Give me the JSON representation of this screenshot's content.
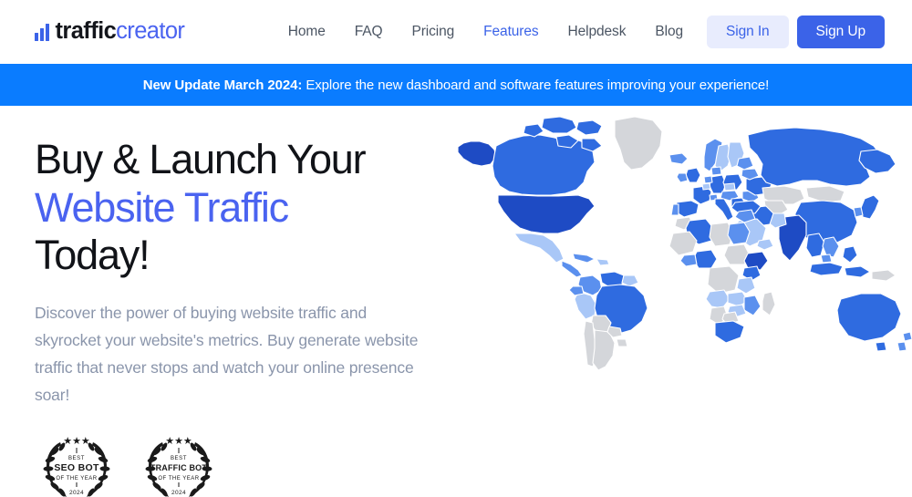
{
  "header": {
    "logo": {
      "word1": "traffic",
      "word2": "creator",
      "icon": "bar-chart-icon"
    },
    "nav": [
      {
        "label": "Home",
        "active": false,
        "name": "nav-link-home"
      },
      {
        "label": "FAQ",
        "active": false,
        "name": "nav-link-faq"
      },
      {
        "label": "Pricing",
        "active": false,
        "name": "nav-link-pricing"
      },
      {
        "label": "Features",
        "active": true,
        "name": "nav-link-features"
      },
      {
        "label": "Helpdesk",
        "active": false,
        "name": "nav-link-helpdesk"
      },
      {
        "label": "Blog",
        "active": false,
        "name": "nav-link-blog"
      }
    ],
    "sign_in_label": "Sign In",
    "sign_up_label": "Sign Up"
  },
  "banner": {
    "bold_prefix": "New Update March 2024:",
    "rest": " Explore the new dashboard and software features improving your experience!"
  },
  "hero": {
    "title_line1": "Buy & Launch Your",
    "title_line2": "Website Traffic",
    "title_line3": "Today!",
    "subtitle": "Discover the power of buying website traffic and skyrocket your website's metrics. Buy generate website traffic that never stops and watch your online presence soar!",
    "badges": [
      {
        "top": "BEST",
        "main": "SEO BOT",
        "sub": "OF THE YEAR",
        "year": "2024",
        "stars": "★★★",
        "name": "award-badge-seo-bot"
      },
      {
        "top": "BEST",
        "main": "TRAFFIC BOT",
        "sub": "OF THE YEAR",
        "year": "2024",
        "stars": "★★★",
        "name": "award-badge-traffic-bot"
      }
    ]
  },
  "map": {
    "alt": "world-traffic-coverage-map",
    "legend_colors": {
      "very_high": "#1e4bc4",
      "high": "#2f6be0",
      "medium": "#5b90ee",
      "low": "#a9c7f7",
      "none": "#d4d6da"
    }
  },
  "theme": {
    "brand_blue": "#3b63e8",
    "banner_blue": "#0a7cff",
    "accent_indigo": "#4a63f0",
    "signin_bg": "#e8ecfd",
    "text_dark": "#111318",
    "text_muted": "#8a95ab",
    "nav_text": "#4b5563"
  }
}
